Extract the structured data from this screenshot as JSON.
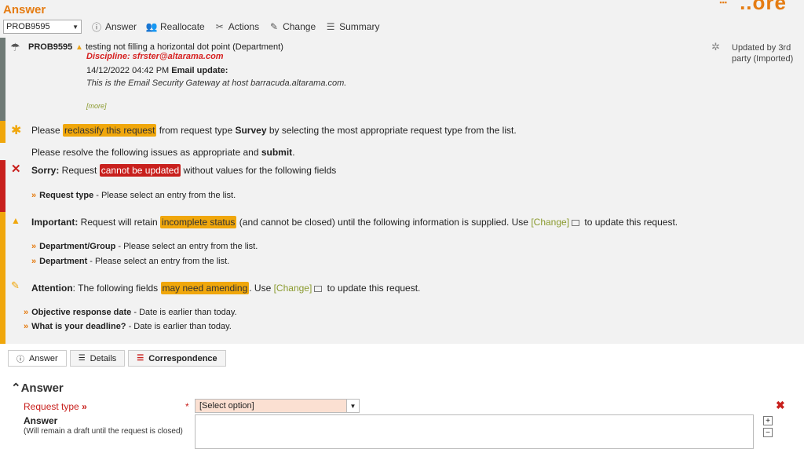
{
  "header": {
    "title": "Answer",
    "logo": "..ore"
  },
  "toolbar": {
    "request_id": "PROB9595",
    "buttons": [
      {
        "label": "Answer",
        "icon": "info-icon"
      },
      {
        "label": "Reallocate",
        "icon": "users-icon"
      },
      {
        "label": "Actions",
        "icon": "tools-icon"
      },
      {
        "label": "Change",
        "icon": "edit-icon"
      },
      {
        "label": "Summary",
        "icon": "list-icon"
      }
    ]
  },
  "request": {
    "id": "PROB9595",
    "subject": "testing not filling a horizontal dot point (Department)",
    "discipline": "Discipline: sfrster@altarama.com",
    "date": "14/12/2022 04:42 PM",
    "update_type": "Email update:",
    "body": "This is the Email Security Gateway at host barracuda.altarama.com.",
    "more": "[more]",
    "updated_by": "Updated by 3rd party (Imported)"
  },
  "reclassify": {
    "pre": "Please ",
    "highlight": "reclassify this request",
    "mid": " from request type ",
    "type": "Survey",
    "post": " by selecting the most appropriate request type from the list.",
    "resolve_pre": "Please resolve the following issues as appropriate and ",
    "resolve_bold": "submit",
    "resolve_post": "."
  },
  "sorry": {
    "label": "Sorry:",
    "pre": " Request ",
    "highlight": "cannot be updated",
    "post": " without values for the following fields",
    "items": [
      {
        "field": "Request type",
        "msg": " - Please select an entry from the list."
      }
    ]
  },
  "important": {
    "label": "Important:",
    "pre": " Request will retain ",
    "highlight": "incomplete status",
    "post": " (and cannot be closed) until the following information is supplied. Use ",
    "link": "[Change]",
    "post2": " to update this request.",
    "items": [
      {
        "field": "Department/Group",
        "msg": " - Please select an entry from the list."
      },
      {
        "field": "Department",
        "msg": " - Please select an entry from the list."
      }
    ]
  },
  "attention": {
    "label": "Attention",
    "pre": ": The following fields ",
    "highlight": "may need amending",
    "post": ". Use ",
    "link": "[Change]",
    "post2": " to update this request.",
    "items": [
      {
        "field": "Objective response date",
        "msg": " -  Date is earlier than today."
      },
      {
        "field": "What is your deadline?",
        "msg": " -  Date is earlier than today."
      }
    ]
  },
  "tabs": [
    "Answer",
    "Details",
    "Correspondence"
  ],
  "form": {
    "section": "Answer",
    "request_type_label": "Request type",
    "request_type_value": "[Select option]",
    "answer_label": "Answer",
    "answer_note": "(Will remain a draft until the request is closed)"
  },
  "colors": {
    "accent": "#e57c12",
    "warning": "#f0a70c",
    "error": "#c8201d"
  }
}
